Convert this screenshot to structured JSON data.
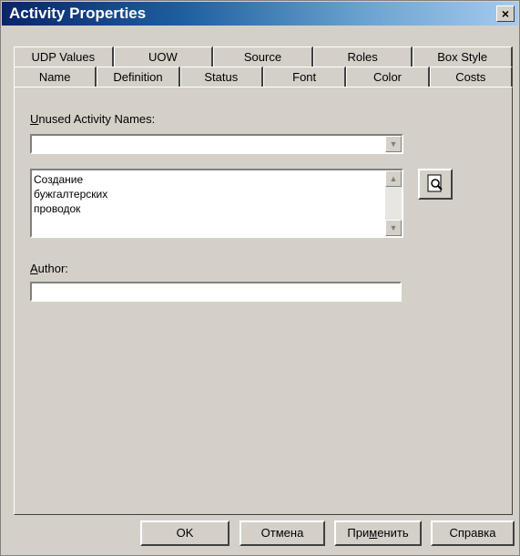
{
  "window": {
    "title": "Activity Properties",
    "close_label": "×"
  },
  "tabs_back": [
    "UDP Values",
    "UOW",
    "Source",
    "Roles",
    "Box Style"
  ],
  "tabs_front": [
    "Name",
    "Definition",
    "Status",
    "Font",
    "Color",
    "Costs"
  ],
  "selected_tab": "Name",
  "name_tab": {
    "unused_label_mnemonic": "U",
    "unused_label_rest": "nused Activity Names:",
    "unused_value": "",
    "activity_name": "Создание\nбужгалтерских\nпроводок",
    "author_label_mnemonic": "A",
    "author_label_rest": "uthor:",
    "author_value": ""
  },
  "buttons": {
    "ok": "OK",
    "cancel": "Отмена",
    "apply_pre": "При",
    "apply_mnemonic": "м",
    "apply_post": "енить",
    "help": "Справка"
  },
  "icons": {
    "close": "close-icon",
    "preview": "preview-icon",
    "dropdown": "chevron-down-icon",
    "scroll_up": "scroll-up-icon",
    "scroll_down": "scroll-down-icon"
  }
}
